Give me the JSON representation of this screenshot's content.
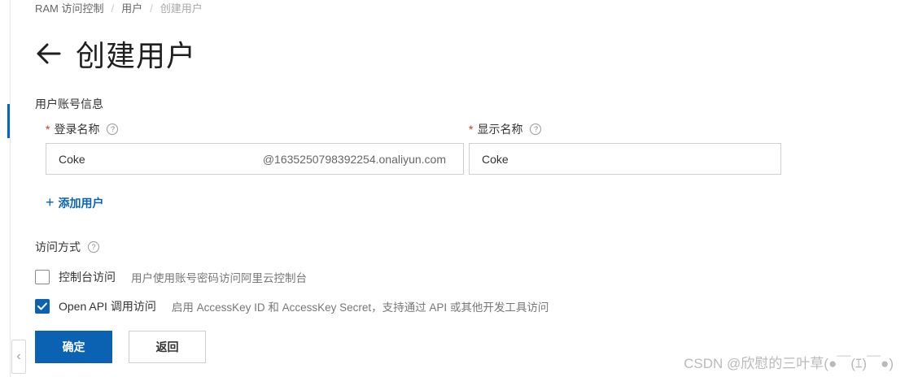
{
  "breadcrumb": {
    "item1": "RAM 访问控制",
    "item2": "用户",
    "item3": "创建用户"
  },
  "page": {
    "title": "创建用户"
  },
  "account_section": {
    "label": "用户账号信息",
    "login_name": {
      "label": "登录名称",
      "required": "*",
      "value": "Coke",
      "suffix": "@1635250798392254.onaliyun.com"
    },
    "display_name": {
      "label": "显示名称",
      "required": "*",
      "value": "Coke"
    },
    "help": "?"
  },
  "add_user": {
    "icon": "+",
    "label": "添加用户"
  },
  "access": {
    "label": "访问方式",
    "console": {
      "label": "控制台访问",
      "description": "用户使用账号密码访问阿里云控制台",
      "checked": false
    },
    "api": {
      "label": "Open API 调用访问",
      "description": "启用 AccessKey ID 和 AccessKey Secret，支持通过 API 或其他开发工具访问",
      "checked": true
    }
  },
  "buttons": {
    "confirm": "确定",
    "back": "返回"
  },
  "icons": {
    "back": "arrow-left-icon",
    "collapse": "chevron-left-icon",
    "help": "question-circle-icon",
    "check": "check-icon"
  },
  "colors": {
    "primary": "#0b62b3",
    "required": "#d93026"
  },
  "watermark": "CSDN @欣慰的三叶草(●￣(ｴ)￣●)"
}
